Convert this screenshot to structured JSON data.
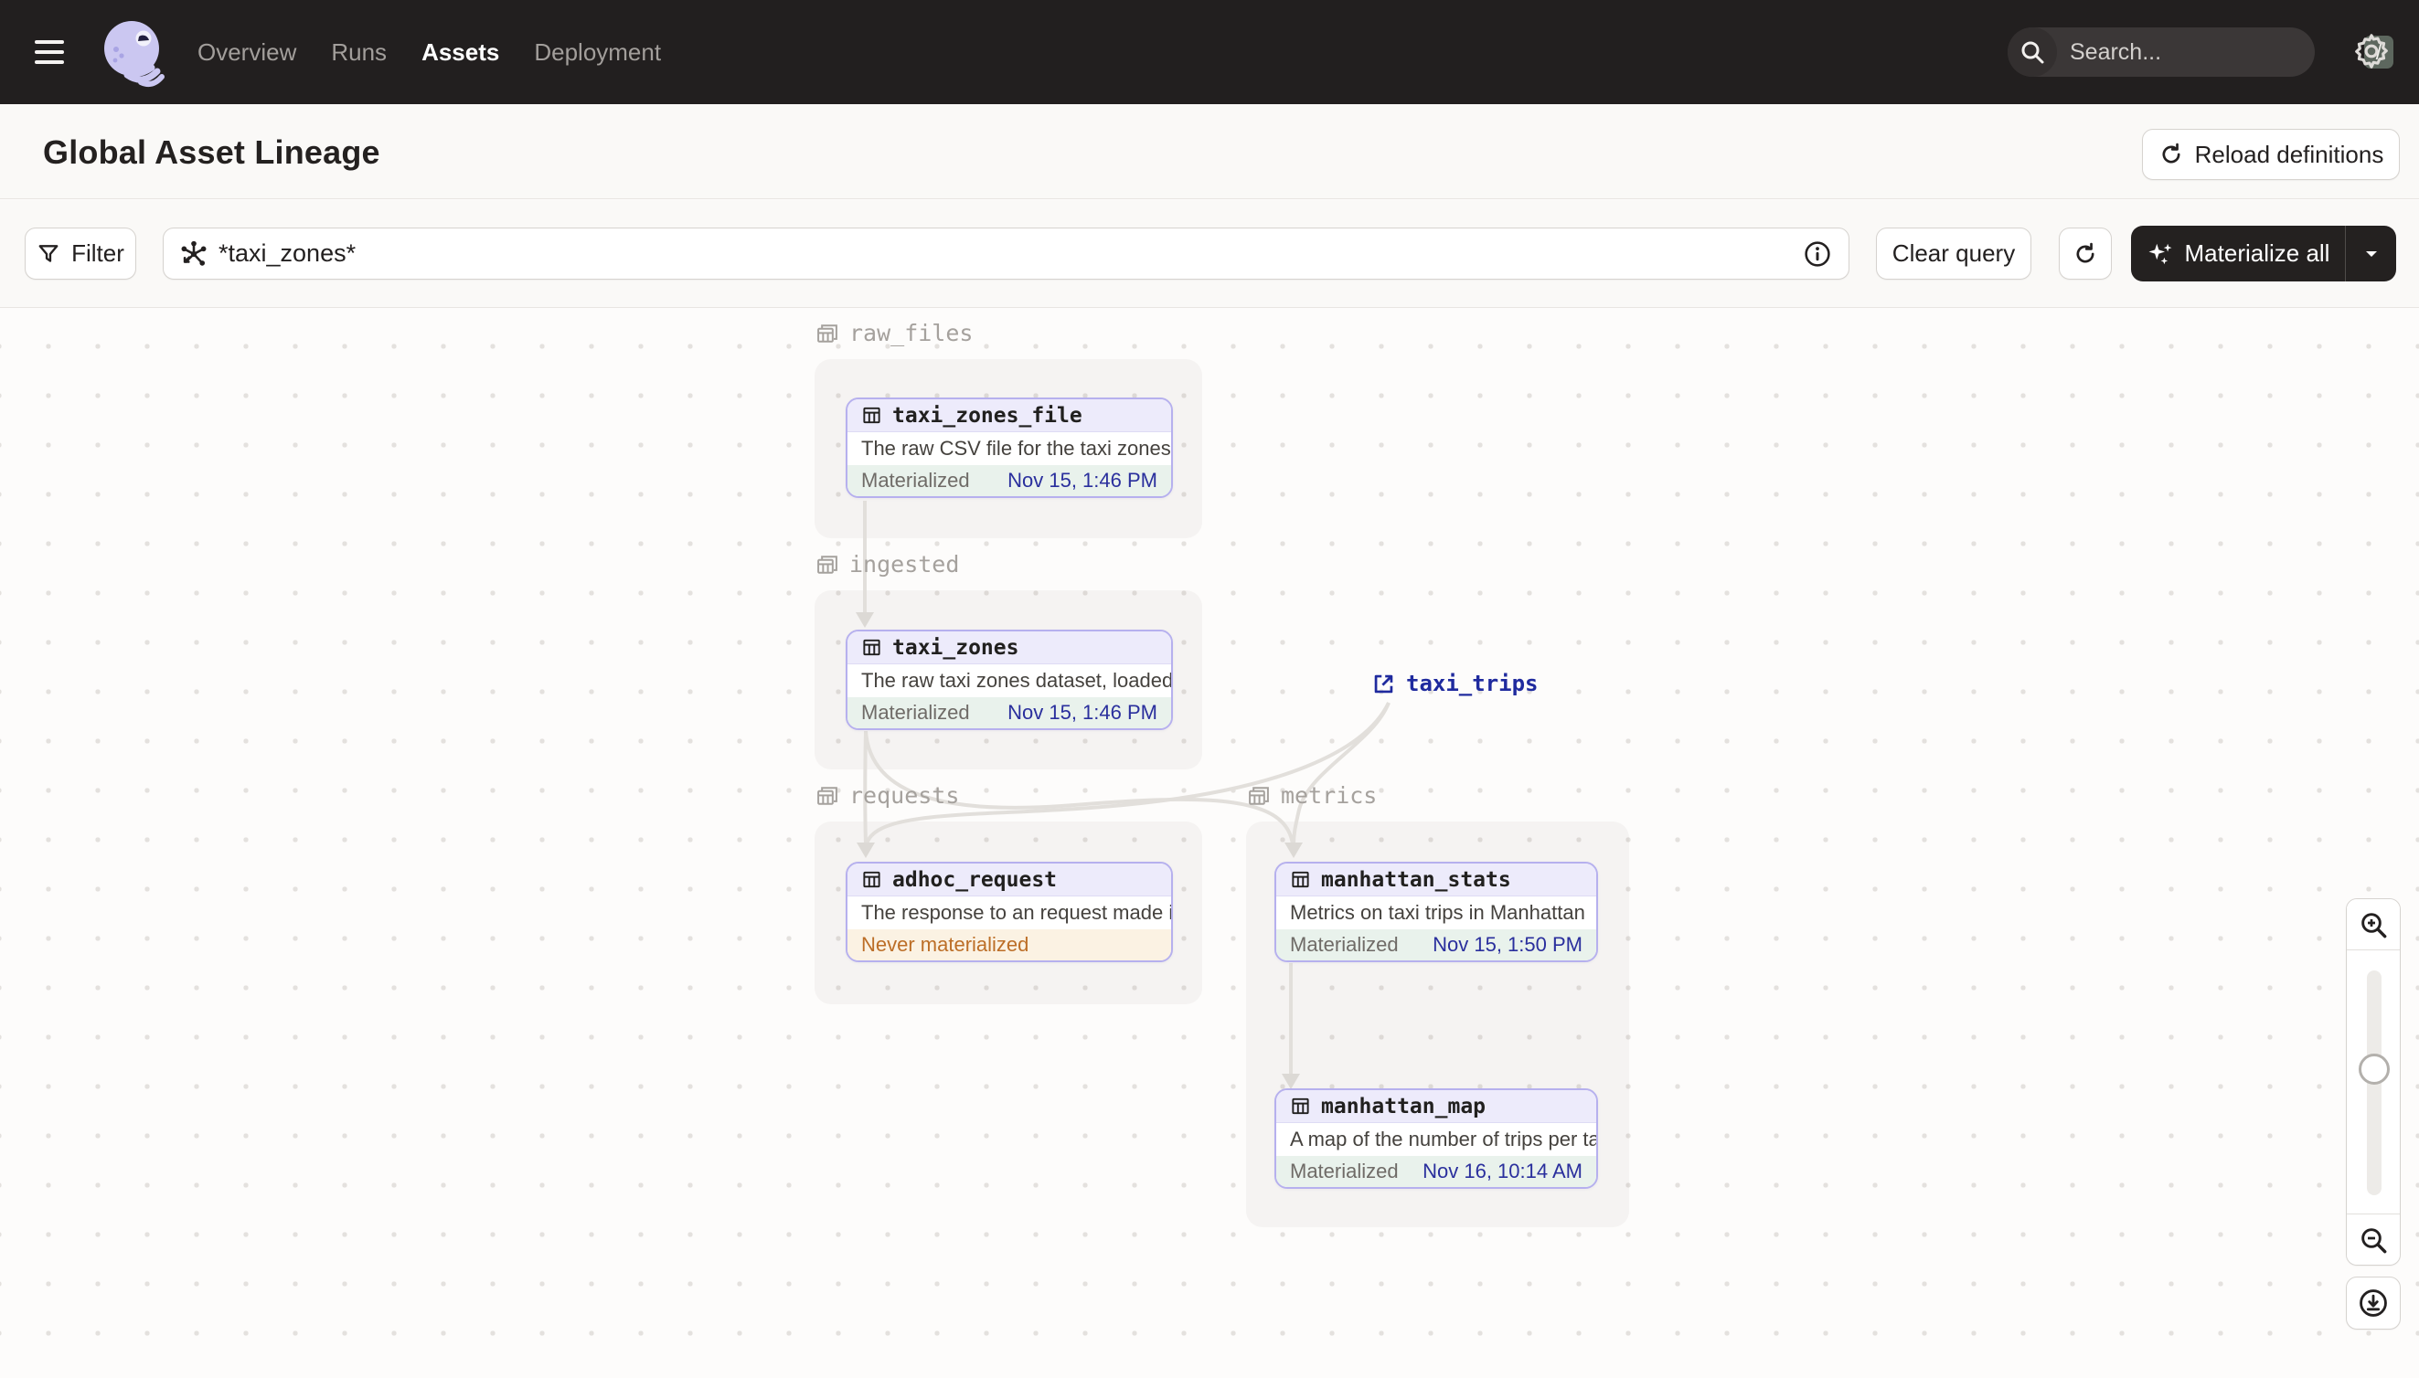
{
  "nav": {
    "items": [
      {
        "label": "Overview",
        "active": false
      },
      {
        "label": "Runs",
        "active": false
      },
      {
        "label": "Assets",
        "active": true
      },
      {
        "label": "Deployment",
        "active": false
      }
    ],
    "search_placeholder": "Search...",
    "search_shortcut": "/"
  },
  "header": {
    "title": "Global Asset Lineage",
    "reload_label": "Reload definitions"
  },
  "toolbar": {
    "filter_label": "Filter",
    "query_value": "*taxi_zones*",
    "clear_label": "Clear query",
    "materialize_label": "Materialize all"
  },
  "graph": {
    "groups": [
      {
        "name": "raw_files"
      },
      {
        "name": "ingested"
      },
      {
        "name": "requests"
      },
      {
        "name": "metrics"
      }
    ],
    "nodes": [
      {
        "name": "taxi_zones_file",
        "description": "The raw CSV file for the taxi zones dat...",
        "status": "Materialized",
        "timestamp": "Nov 15, 1:46 PM"
      },
      {
        "name": "taxi_zones",
        "description": "The raw taxi zones dataset, loaded int...",
        "status": "Materialized",
        "timestamp": "Nov 15, 1:46 PM"
      },
      {
        "name": "adhoc_request",
        "description": "The response to an request made in th...",
        "status": "Never materialized",
        "timestamp": ""
      },
      {
        "name": "manhattan_stats",
        "description": "Metrics on taxi trips in Manhattan",
        "status": "Materialized",
        "timestamp": "Nov 15, 1:50 PM"
      },
      {
        "name": "manhattan_map",
        "description": "A map of the number of trips per taxi z...",
        "status": "Materialized",
        "timestamp": "Nov 16, 10:14 AM"
      }
    ],
    "external_assets": [
      {
        "name": "taxi_trips"
      }
    ]
  },
  "colors": {
    "nav_background": "#221f1f",
    "node_border": "#b6b0ee",
    "node_header_bg": "#edebfb",
    "materialized_bg": "#e9f2ec",
    "never_materialized_bg": "#fbf2e3",
    "never_materialized_text": "#bc6e27",
    "timestamp_text": "#2a2f9d",
    "external_asset_text": "#1f2a9e",
    "edge_color": "#e2dfdb"
  }
}
